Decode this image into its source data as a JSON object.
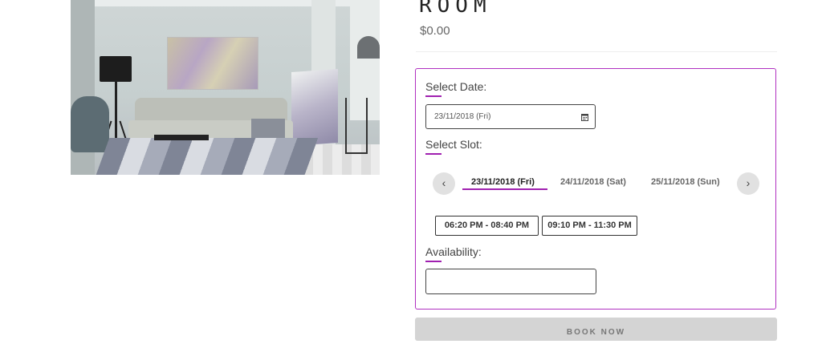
{
  "product": {
    "title": "ROOM",
    "price": "$0.00"
  },
  "booking": {
    "select_date_label": "Select Date:",
    "date_value": "23/11/2018 (Fri)",
    "select_slot_label": "Select Slot:",
    "date_tabs": [
      {
        "label": "23/11/2018 (Fri)",
        "active": true
      },
      {
        "label": "24/11/2018 (Sat)",
        "active": false
      },
      {
        "label": "25/11/2018 (Sun)",
        "active": false
      }
    ],
    "time_slots": [
      "06:20 PM - 08:40 PM",
      "09:10 PM - 11:30 PM"
    ],
    "availability_label": "Availability:",
    "availability_value": "",
    "book_button": "BOOK NOW",
    "prev_icon": "chevron-left-icon",
    "next_icon": "chevron-right-icon",
    "calendar_icon": "calendar-icon"
  },
  "colors": {
    "accent": "#a020b0",
    "button_bg": "#d4d4d4"
  }
}
